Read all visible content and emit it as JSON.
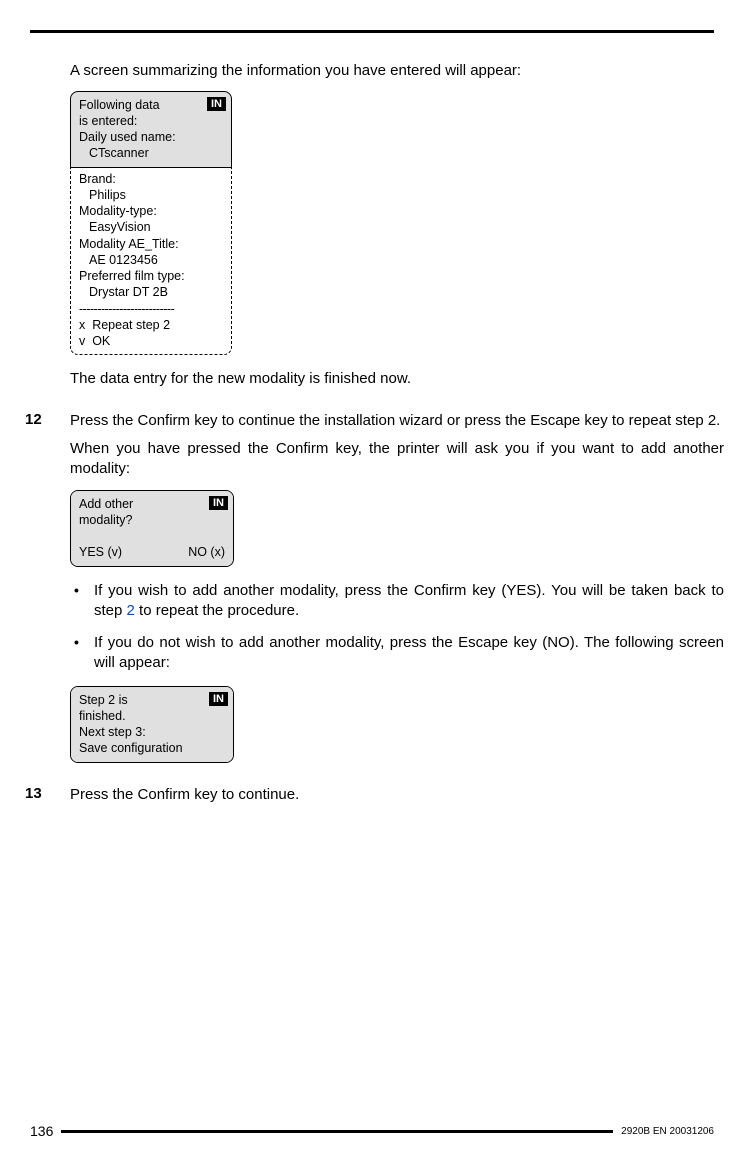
{
  "intro": "A screen summarizing the information you have entered will appear:",
  "lcd1": {
    "badge": "IN",
    "top_lines": {
      "l1": "Following data",
      "l2": "is entered:",
      "l3": "Daily used name:",
      "l4": "CTscanner"
    },
    "bottom_lines": {
      "l1": "Brand:",
      "l2": "Philips",
      "l3": "Modality-type:",
      "l4": "EasyVision",
      "l5": "Modality AE_Title:",
      "l6": "AE 0123456",
      "l7": "Preferred film type:",
      "l8": "Drystar DT 2B",
      "sep": "--------------------------",
      "l9": "x  Repeat step 2",
      "l10": "v  OK"
    }
  },
  "para2": "The data entry for the new modality is finished now.",
  "step12": {
    "num": "12",
    "p1": "Press the Confirm key to continue the installation wizard or press the Escape key to repeat step 2.",
    "p2": "When you have pressed the Confirm key, the printer will ask you if you want to add another modality:"
  },
  "lcd2": {
    "badge": "IN",
    "l1": "Add other",
    "l2": "modality?",
    "yes": "YES (v)",
    "no": "NO (x)"
  },
  "bullets": {
    "b1_a": "If you wish to add another modality, press the Confirm key (YES). You will be taken back to step ",
    "b1_link": "2",
    "b1_b": " to repeat the procedure.",
    "b2": "If you do not wish to add another modality, press the Escape key (NO). The following screen will appear:"
  },
  "lcd3": {
    "badge": "IN",
    "l1": "Step 2 is",
    "l2": "finished.",
    "l3": "Next step 3:",
    "l4": "Save configuration"
  },
  "step13": {
    "num": "13",
    "p1": "Press the Confirm key to continue."
  },
  "footer": {
    "page": "136",
    "doc_id": "2920B EN 20031206"
  }
}
